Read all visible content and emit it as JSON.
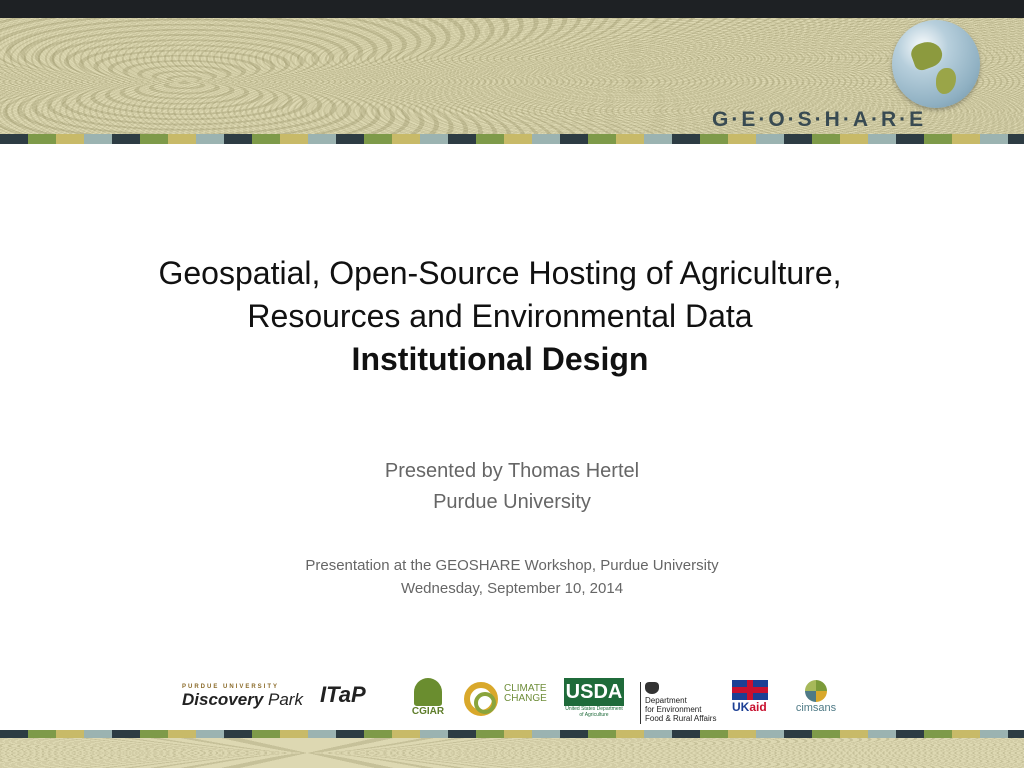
{
  "header": {
    "brand": "G·E·O·S·H·A·R·E"
  },
  "title": {
    "line1": "Geospatial, Open-Source Hosting of Agriculture,",
    "line2": "Resources and Environmental Data",
    "line3": "Institutional Design"
  },
  "presenter": {
    "line1": "Presented by Thomas Hertel",
    "line2": "Purdue University"
  },
  "event": {
    "line1": "Presentation at the GEOSHARE Workshop, Purdue University",
    "line2": "Wednesday, September 10, 2014"
  },
  "logos": {
    "discovery_small": "PURDUE UNIVERSITY",
    "discovery_main": "Discovery",
    "discovery_park": "Park",
    "itap": "ITaP",
    "cgiar": "CGIAR",
    "ccafs_line1": "CLIMATE",
    "ccafs_line2": "CHANGE",
    "usda": "USDA",
    "usda_sub": "United States Department of Agriculture",
    "defra_line1": "Department",
    "defra_line2": "for Environment",
    "defra_line3": "Food & Rural Affairs",
    "ukaid_uk": "UK",
    "ukaid_aid": "aid",
    "cimsans": "cimsans"
  }
}
